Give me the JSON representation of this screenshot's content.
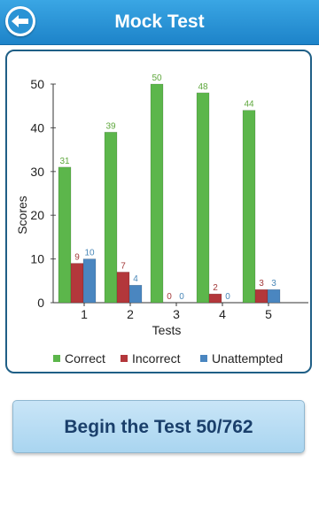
{
  "header": {
    "title": "Mock Test",
    "back_icon": "back-arrow-icon"
  },
  "colors": {
    "header": "#2894d6",
    "correct": "#5cb64b",
    "incorrect": "#b3373b",
    "unattempted": "#4a86c0",
    "label_correct": "#5ea73c",
    "label_incorrect": "#a33a3a",
    "label_unattempted": "#4a88b8"
  },
  "chart_data": {
    "type": "bar",
    "categories": [
      "1",
      "2",
      "3",
      "4",
      "5"
    ],
    "series": [
      {
        "name": "Correct",
        "values": [
          31,
          39,
          50,
          48,
          44
        ]
      },
      {
        "name": "Incorrect",
        "values": [
          9,
          7,
          0,
          2,
          3
        ]
      },
      {
        "name": "Unattempted",
        "values": [
          10,
          4,
          0,
          0,
          3
        ]
      }
    ],
    "xlabel": "Tests",
    "ylabel": "Scores",
    "ylim": [
      0,
      50
    ],
    "yticks": [
      0,
      10,
      20,
      30,
      40,
      50
    ],
    "grid": false,
    "legend_position": "bottom"
  },
  "action": {
    "begin_label": "Begin the Test 50/762"
  }
}
